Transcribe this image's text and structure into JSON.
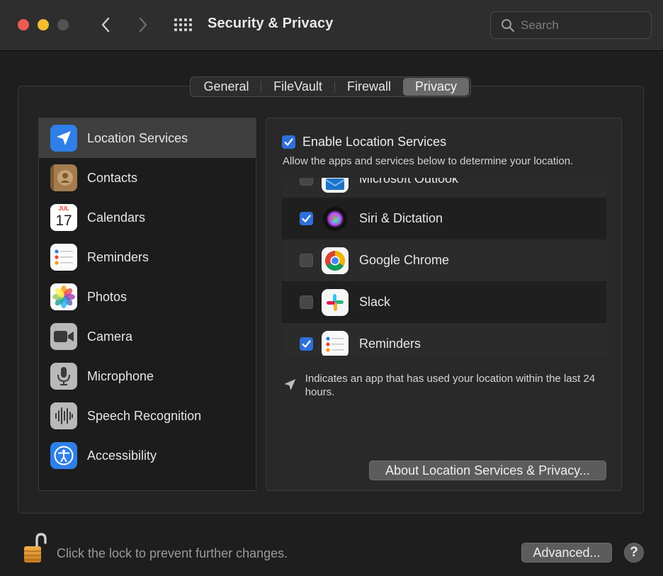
{
  "window": {
    "title": "Security & Privacy",
    "search_placeholder": "Search"
  },
  "tabs": [
    {
      "label": "General"
    },
    {
      "label": "FileVault"
    },
    {
      "label": "Firewall"
    },
    {
      "label": "Privacy",
      "selected": true
    }
  ],
  "sidebar": {
    "items": [
      {
        "label": "Location Services",
        "icon": "location-arrow-icon",
        "selected": true
      },
      {
        "label": "Contacts",
        "icon": "contacts-icon"
      },
      {
        "label": "Calendars",
        "icon": "calendar-icon",
        "month": "JUL",
        "day": "17"
      },
      {
        "label": "Reminders",
        "icon": "reminders-icon"
      },
      {
        "label": "Photos",
        "icon": "photos-icon"
      },
      {
        "label": "Camera",
        "icon": "camera-icon"
      },
      {
        "label": "Microphone",
        "icon": "microphone-icon"
      },
      {
        "label": "Speech Recognition",
        "icon": "waveform-icon"
      },
      {
        "label": "Accessibility",
        "icon": "accessibility-icon"
      }
    ]
  },
  "location": {
    "enable_label": "Enable Location Services",
    "enable_checked": true,
    "description": "Allow the apps and services below to determine your location.",
    "apps": [
      {
        "name": "Microsoft Outlook",
        "checked": false,
        "icon": "outlook-icon"
      },
      {
        "name": "Siri & Dictation",
        "checked": true,
        "icon": "siri-icon"
      },
      {
        "name": "Google Chrome",
        "checked": false,
        "icon": "chrome-icon"
      },
      {
        "name": "Slack",
        "checked": false,
        "icon": "slack-icon"
      },
      {
        "name": "Reminders",
        "checked": true,
        "icon": "reminders-icon"
      }
    ],
    "note": "Indicates an app that has used your location within the last 24 hours.",
    "about_button": "About Location Services & Privacy..."
  },
  "footer": {
    "lock_text": "Click the lock to prevent further changes.",
    "advanced_button": "Advanced...",
    "help_label": "?"
  },
  "colors": {
    "accent": "#2f6fd9",
    "close": "#ee5a52",
    "minimize": "#f5bd30"
  }
}
